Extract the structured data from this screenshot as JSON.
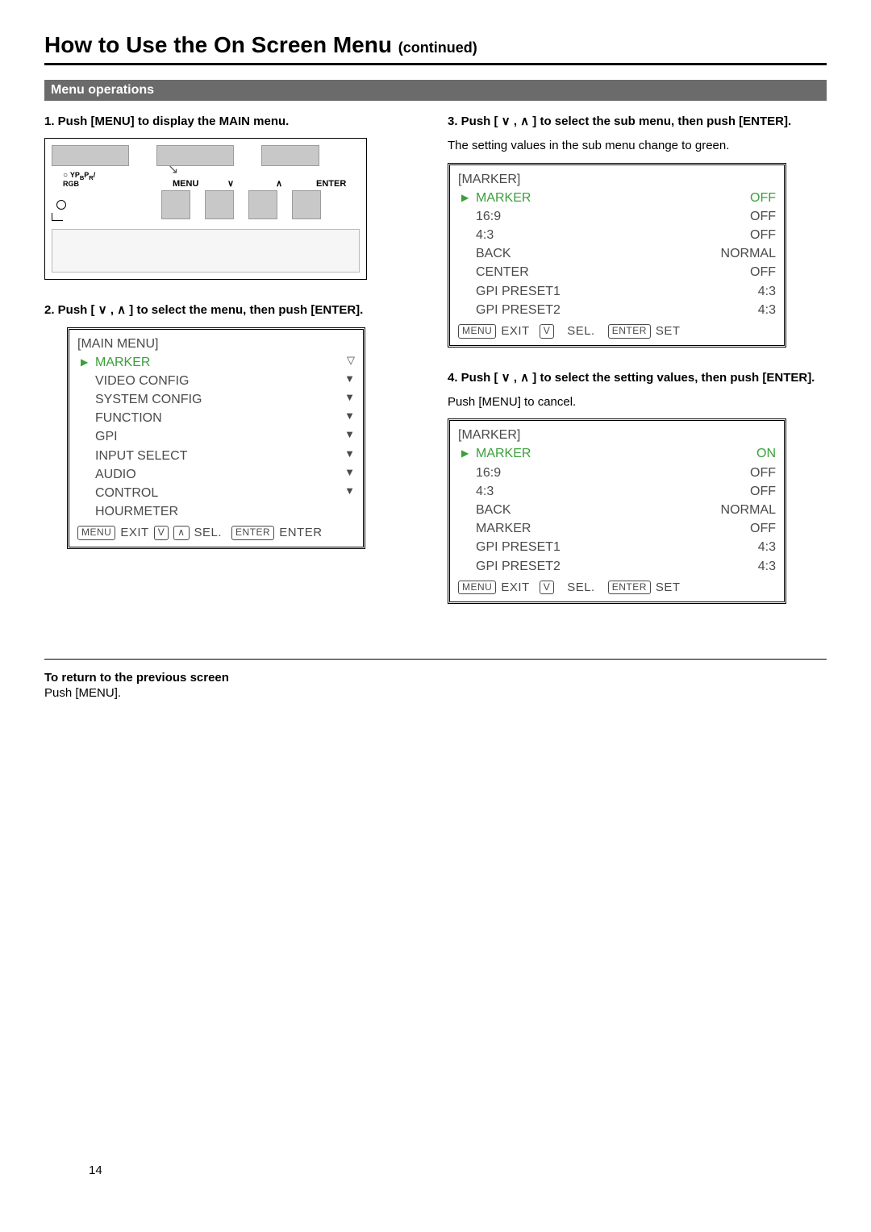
{
  "title_main": "How to Use the On Screen Menu ",
  "title_cont": "(continued)",
  "section_bar": "Menu operations",
  "step1_heading": "1. Push [MENU] to display the MAIN menu.",
  "panel": {
    "rgb_label": "YPBPR/\nRGB",
    "menu_label": "MENU",
    "enter_label": "ENTER",
    "down_sym": "∨",
    "up_sym": "∧"
  },
  "step2_heading": "2. Push [ ∨ , ∧ ] to select the menu, then push [ENTER].",
  "main_menu": {
    "title": "[MAIN MENU]",
    "items": [
      "MARKER",
      "VIDEO CONFIG",
      "SYSTEM CONFIG",
      "FUNCTION",
      "GPI",
      "INPUT SELECT",
      "AUDIO",
      "CONTROL",
      "HOURMETER"
    ],
    "footer_exit": "EXIT",
    "footer_sel": "SEL.",
    "footer_enter_action": "ENTER"
  },
  "step3_heading": "3. Push [ ∨ , ∧ ] to select the sub menu, then push [ENTER].",
  "step3_body": "The setting values in the sub menu change to green.",
  "marker_menu_a": {
    "title": "[MARKER]",
    "rows": [
      {
        "label": "MARKER",
        "value": "OFF",
        "sel": true
      },
      {
        "label": "16:9",
        "value": "OFF"
      },
      {
        "label": "4:3",
        "value": "OFF"
      },
      {
        "label": "BACK",
        "value": "NORMAL"
      },
      {
        "label": "CENTER",
        "value": "OFF"
      },
      {
        "label": "GPI PRESET1",
        "value": "4:3"
      },
      {
        "label": "GPI PRESET2",
        "value": "4:3"
      }
    ],
    "footer_sel": "SEL.",
    "footer_set": "SET"
  },
  "step4_heading": "4. Push [ ∨ , ∧ ] to select the setting values, then push [ENTER].",
  "step4_body": "Push [MENU] to cancel.",
  "marker_menu_b": {
    "title": "[MARKER]",
    "rows": [
      {
        "label": "MARKER",
        "value": "ON",
        "sel": true,
        "valgreen": true
      },
      {
        "label": "16:9",
        "value": "OFF"
      },
      {
        "label": "4:3",
        "value": "OFF"
      },
      {
        "label": "BACK",
        "value": "NORMAL"
      },
      {
        "label": "MARKER",
        "value": "OFF"
      },
      {
        "label": "GPI PRESET1",
        "value": "4:3"
      },
      {
        "label": "GPI PRESET2",
        "value": "4:3"
      }
    ],
    "footer_sel": "SEL.",
    "footer_set": "SET"
  },
  "return_heading": "To return to the previous screen",
  "return_body": "Push [MENU].",
  "key_menu": "MENU",
  "key_enter": "ENTER",
  "key_v": "V",
  "key_up": "∧",
  "page_number": "14"
}
